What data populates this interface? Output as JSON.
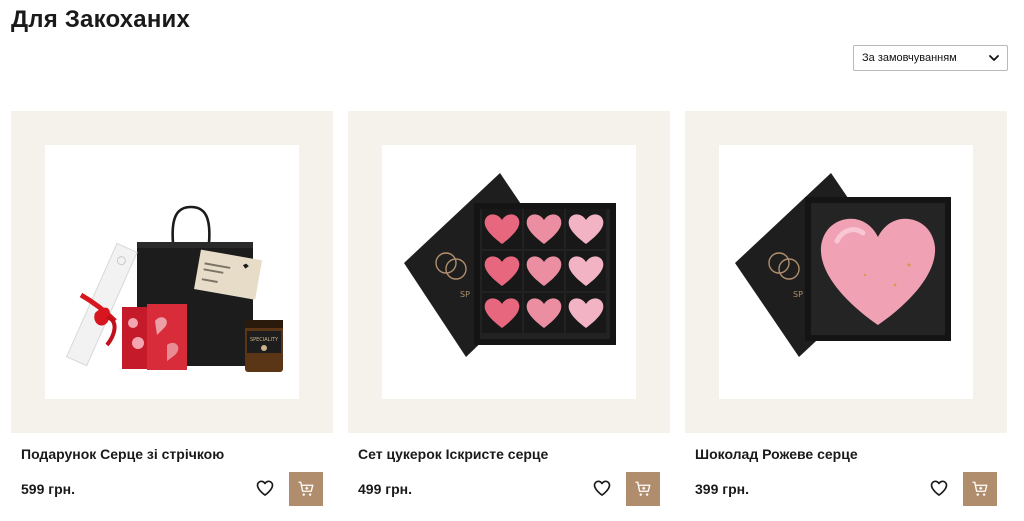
{
  "page": {
    "title": "Для Закоханих"
  },
  "sort": {
    "selected": "За замовчуванням"
  },
  "products": [
    {
      "name": "Подарунок Серце зі стрічкою",
      "price": "599 грн."
    },
    {
      "name": "Сет цукерок Іскристе серце",
      "price": "499 грн."
    },
    {
      "name": "Шоколад Рожеве серце",
      "price": "399 грн."
    }
  ],
  "packaging_texts": {
    "jar_label": "SPECIALITY",
    "box_brand": "SP"
  },
  "icons": {
    "sort": "chevron-down-icon",
    "wishlist": "heart-outline-icon",
    "cart": "shopping-cart-icon"
  },
  "colors": {
    "accent": "#b08e6d",
    "card_bg": "#f5f2ec",
    "text": "#1a1a1a"
  }
}
